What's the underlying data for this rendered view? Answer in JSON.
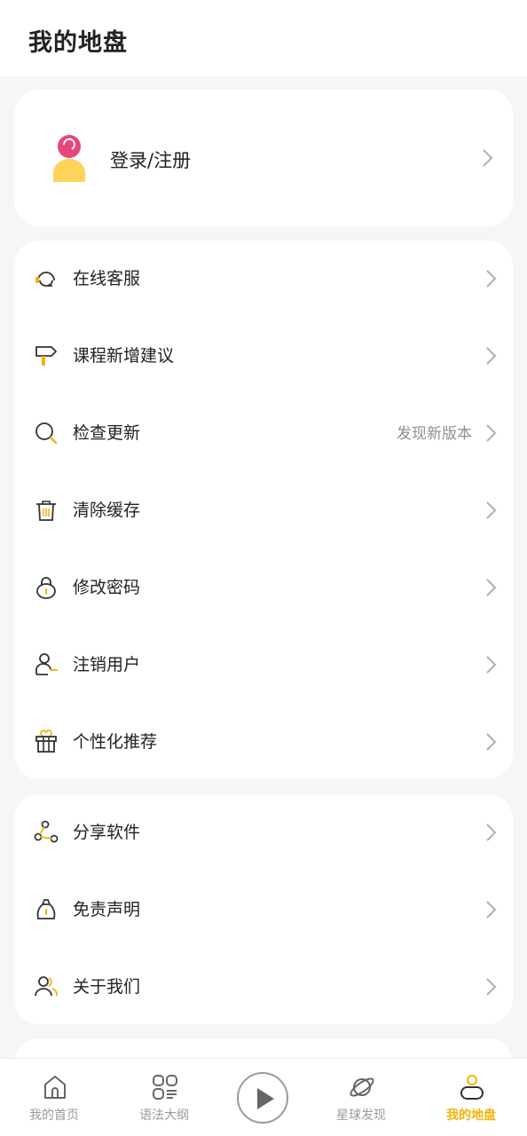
{
  "header": {
    "title": "我的地盘"
  },
  "login": {
    "label": "登录/注册"
  },
  "menu_primary": [
    {
      "label": "在线客服",
      "icon": "headset-icon"
    },
    {
      "label": "课程新增建议",
      "icon": "signpost-icon"
    },
    {
      "label": "检查更新",
      "icon": "search-icon",
      "extra": "发现新版本"
    },
    {
      "label": "清除缓存",
      "icon": "trash-icon"
    },
    {
      "label": "修改密码",
      "icon": "lock-icon"
    },
    {
      "label": "注销用户",
      "icon": "user-minus-icon"
    },
    {
      "label": "个性化推荐",
      "icon": "gift-icon"
    }
  ],
  "menu_secondary": [
    {
      "label": "分享软件",
      "icon": "share-icon"
    },
    {
      "label": "免责声明",
      "icon": "bag-icon"
    },
    {
      "label": "关于我们",
      "icon": "users-icon"
    }
  ],
  "tabbar": {
    "items": [
      {
        "label": "我的首页",
        "icon": "home-icon",
        "active": false
      },
      {
        "label": "语法大纲",
        "icon": "grid-icon",
        "active": false
      },
      {
        "label": "",
        "icon": "play-icon",
        "active": false
      },
      {
        "label": "星球发现",
        "icon": "planet-icon",
        "active": false
      },
      {
        "label": "我的地盘",
        "icon": "profile-icon",
        "active": true
      }
    ]
  },
  "colors": {
    "accent": "#f2b40c",
    "avatar_head": "#e8457a",
    "avatar_body": "#fdd35a",
    "background": "#f5f6f5"
  }
}
